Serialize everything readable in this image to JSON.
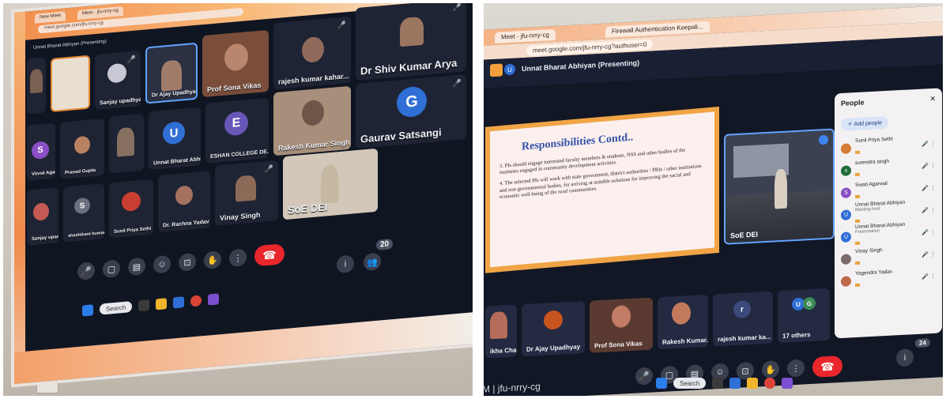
{
  "left_photo": {
    "browser_tabs": [
      "New Meet",
      "Meet · jfu-nrry-cg"
    ],
    "url": "meet.google.com/jfu-nrry-cg",
    "meeting_title": "Unnat Bharat Abhiyan (Presenting)",
    "tiles": [
      {
        "name": "Sanjay upadhyay"
      },
      {
        "name": "Dr Ajay Upadhyay"
      },
      {
        "name": "Prof Sona Vikas"
      },
      {
        "name": "rajesh kumar kahar..."
      },
      {
        "name": "Dr Shiv Kumar Arya"
      },
      {
        "name": "Vinod Agarwal"
      },
      {
        "name": "Prasad Gupta"
      },
      {
        "name": "Unnat Bharat Abhiyan",
        "initial": "U"
      },
      {
        "name": "ESHAN COLLEGE DE...",
        "initial": "E"
      },
      {
        "name": "Rakesh Kumar Singh"
      },
      {
        "name": "Gaurav Satsangi",
        "initial": "G"
      },
      {
        "name": "Sanjay upadhyay"
      },
      {
        "name": "shashikant kumar",
        "initial": "S"
      },
      {
        "name": "Sunil Priya Sethi"
      },
      {
        "name": "Dr. Rachna Yadav"
      },
      {
        "name": "Vinay Singh"
      },
      {
        "name": "SoE DEI"
      }
    ],
    "participants_count": "20",
    "info_icon": "info-icon",
    "people_icon": "people-icon",
    "taskbar_search": "Search"
  },
  "right_photo": {
    "browser_tabs": [
      "Meet · jfu-nrry-cg",
      "Firewall Authentication Keepali..."
    ],
    "url": "meet.google.com/jfu-nrry-cg?authuser=0",
    "meeting_title": "Unnat Bharat Abhiyan (Presenting)",
    "slide": {
      "title": "Responsibilities Contd..",
      "points": [
        "3. PIs should engage interested faculty members & students, NSS and other bodies of the institutes engaged in community development activities.",
        "4. The selected PIs will work with state government, district authorities / PRIs / other institutions and non governmental bodies, for arriving at suitable solutions for improving the social and economic well-being of the rural communities."
      ]
    },
    "presenter_tile": "SoE DEI",
    "people_panel": {
      "title": "People",
      "add_people": "Add people",
      "people": [
        {
          "name": "Sunil Priya Sethi",
          "sub": "",
          "color": "#d67b34"
        },
        {
          "name": "surendra singh",
          "sub": "",
          "color": "#1e6b3a",
          "initial": "s"
        },
        {
          "name": "Swati Agarwal",
          "sub": "",
          "color": "#8a4fc4",
          "initial": "S"
        },
        {
          "name": "Unnat Bharat Abhiyan",
          "sub": "Meeting host",
          "color": "#2f6fd6",
          "initial": "U"
        },
        {
          "name": "Unnat Bharat Abhiyan",
          "sub": "Presentation",
          "color": "#2f6fd6",
          "initial": "U"
        },
        {
          "name": "Vinay Singh",
          "sub": "",
          "color": "#7a6a6a"
        },
        {
          "name": "Yogendra Yadav",
          "sub": "",
          "color": "#c0684a"
        }
      ]
    },
    "strip_tiles": [
      {
        "name": "ikha Chau..."
      },
      {
        "name": "Dr Ajay Upadhyay"
      },
      {
        "name": "Prof Sona Vikas"
      },
      {
        "name": "Rakesh Kumar..."
      },
      {
        "name": "rajesh kumar ka..."
      },
      {
        "name": "17 others"
      }
    ],
    "meeting_code": "M | jfu-nrry-cg",
    "participants_count": "24",
    "taskbar_search": "Search",
    "colors": {
      "slide_title": "#3552a8",
      "slide_frame": "#f0a446",
      "end_call": "#e8262b"
    }
  }
}
